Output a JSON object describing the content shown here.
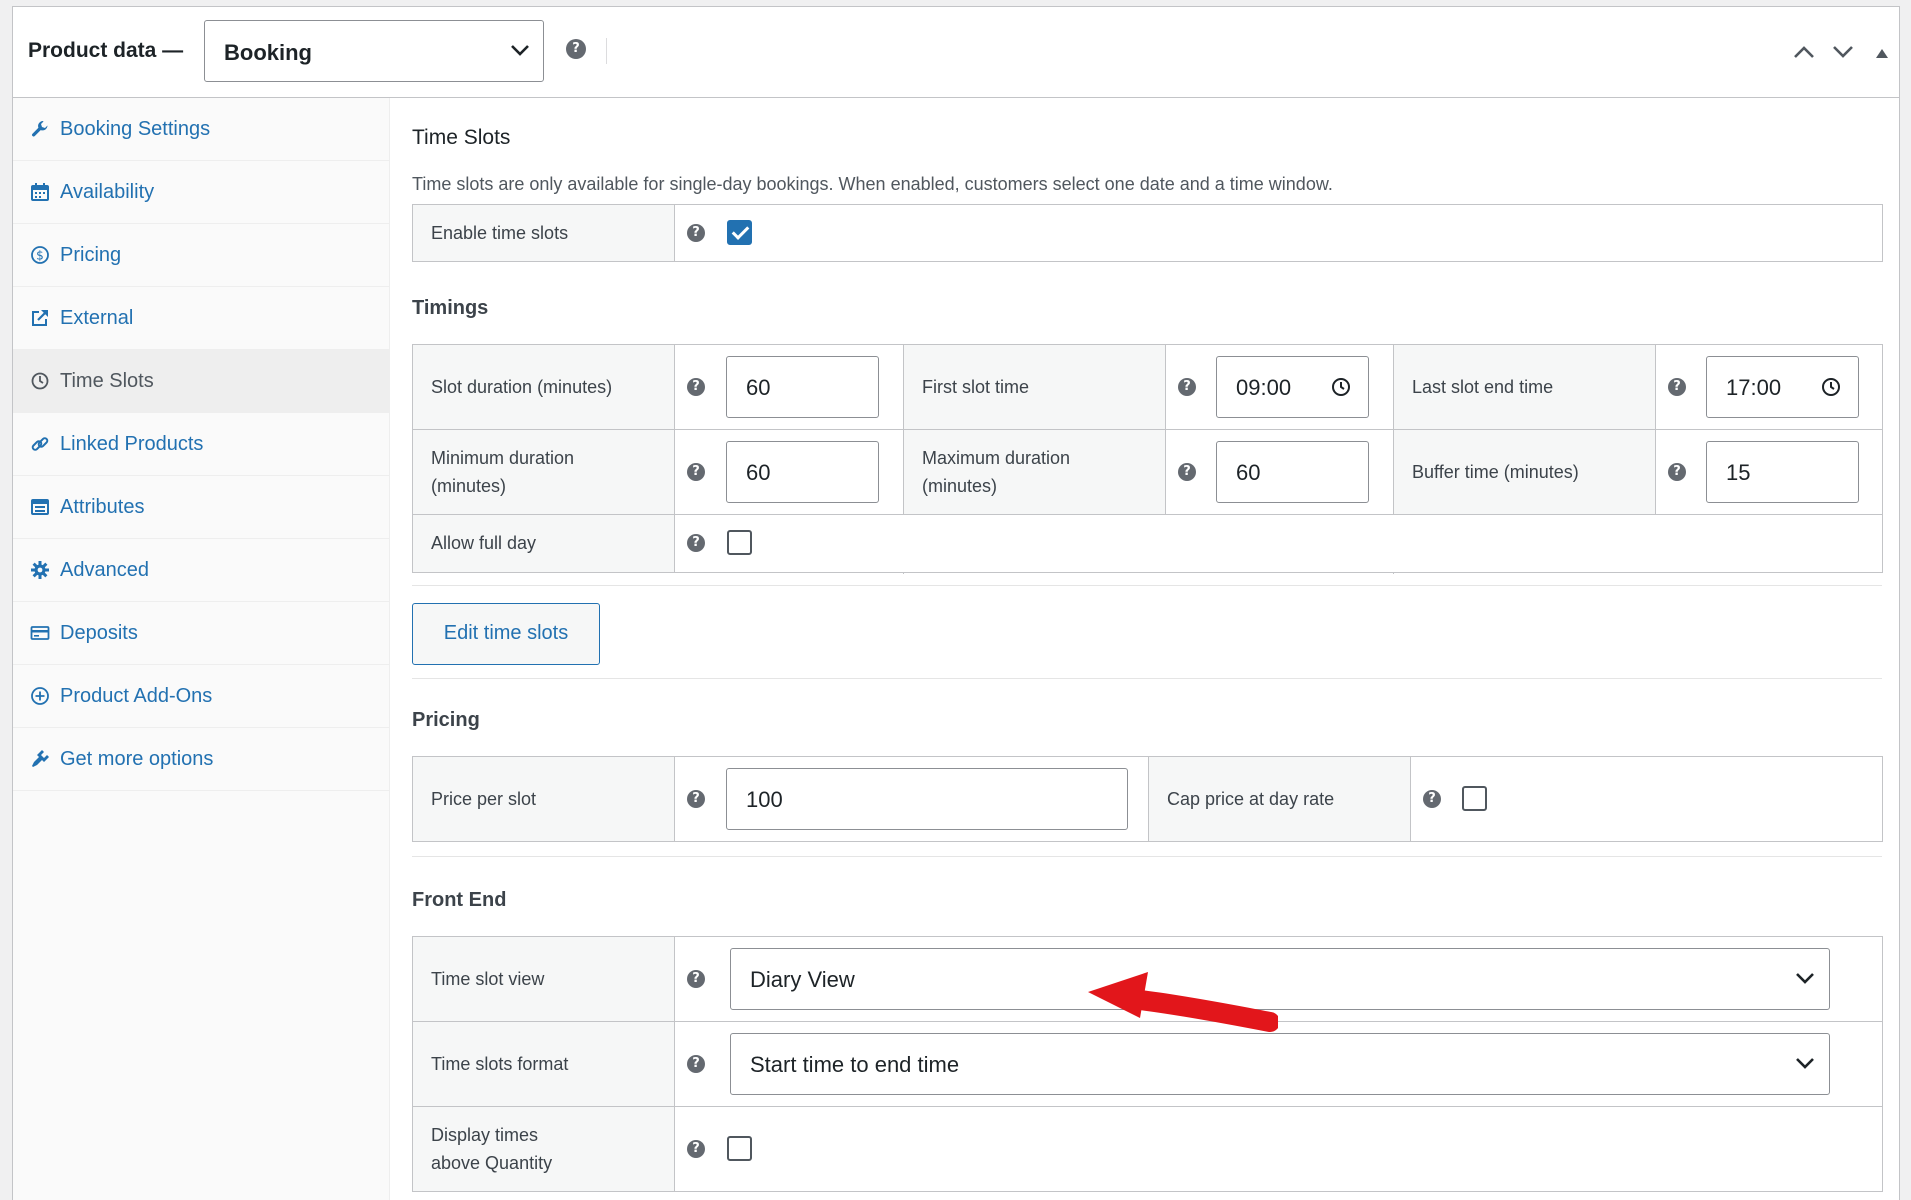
{
  "header": {
    "title": "Product data —",
    "product_type": "Booking"
  },
  "sidebar": {
    "items": [
      {
        "label": "Booking Settings",
        "icon": "wrench-icon"
      },
      {
        "label": "Availability",
        "icon": "calendar-icon"
      },
      {
        "label": "Pricing",
        "icon": "dollar-icon"
      },
      {
        "label": "External",
        "icon": "external-link-icon"
      },
      {
        "label": "Time Slots",
        "icon": "clock-icon",
        "active": true
      },
      {
        "label": "Linked Products",
        "icon": "link-icon"
      },
      {
        "label": "Attributes",
        "icon": "list-icon"
      },
      {
        "label": "Advanced",
        "icon": "gear-icon"
      },
      {
        "label": "Deposits",
        "icon": "card-icon"
      },
      {
        "label": "Product Add-Ons",
        "icon": "plus-circle-icon"
      },
      {
        "label": "Get more options",
        "icon": "plugin-icon"
      }
    ]
  },
  "time_slots": {
    "title": "Time Slots",
    "description": "Time slots are only available for single-day bookings. When enabled, customers select one date and a time window.",
    "enable_label": "Enable time slots",
    "enabled": true
  },
  "timings": {
    "heading": "Timings",
    "slot_duration_label": "Slot duration (minutes)",
    "slot_duration": "60",
    "first_slot_label": "First slot time",
    "first_slot": "09:00",
    "last_slot_label": "Last slot end time",
    "last_slot": "17:00",
    "min_duration_label_1": "Minimum duration",
    "min_duration_label_2": "(minutes)",
    "min_duration": "60",
    "max_duration_label_1": "Maximum duration",
    "max_duration_label_2": "(minutes)",
    "max_duration": "60",
    "buffer_label": "Buffer time (minutes)",
    "buffer": "15",
    "allow_full_day_label": "Allow full day",
    "allow_full_day": false
  },
  "edit_button": "Edit time slots",
  "pricing": {
    "heading": "Pricing",
    "price_label": "Price per slot",
    "price": "100",
    "cap_label": "Cap price at day rate",
    "cap": false
  },
  "front_end": {
    "heading": "Front End",
    "view_label": "Time slot view",
    "view": "Diary View",
    "format_label": "Time slots format",
    "format": "Start time to end time",
    "display_label_1": "Display times",
    "display_label_2": "above Quantity",
    "display": false
  },
  "colors": {
    "accent": "#2271b1",
    "arrow": "#e2161b"
  }
}
